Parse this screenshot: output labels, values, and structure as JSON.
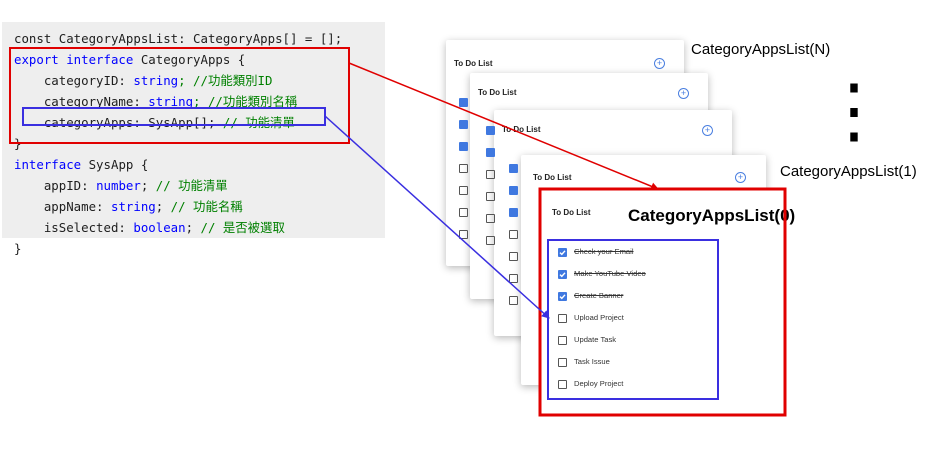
{
  "code_lines": [
    [
      {
        "t": "const CategoryAppsList: CategoryApps[] = [];",
        "c": ""
      }
    ],
    [
      {
        "t": "export interface",
        "c": "kw"
      },
      {
        "t": " CategoryApps {",
        "c": ""
      }
    ],
    [
      {
        "t": "    categoryID: ",
        "c": ""
      },
      {
        "t": "string",
        "c": "kw"
      },
      {
        "t": "; //功能類別ID",
        "c": "cm"
      }
    ],
    [
      {
        "t": "    categoryName: ",
        "c": ""
      },
      {
        "t": "string",
        "c": "kw"
      },
      {
        "t": "; //功能類別名稱",
        "c": "cm"
      }
    ],
    [
      {
        "t": "    categoryApps: SysApp[]; ",
        "c": ""
      },
      {
        "t": "// 功能清單",
        "c": "cm"
      }
    ],
    [
      {
        "t": "}",
        "c": ""
      }
    ],
    [
      {
        "t": "interface",
        "c": "kw"
      },
      {
        "t": " SysApp {",
        "c": ""
      }
    ],
    [
      {
        "t": "    appID: ",
        "c": ""
      },
      {
        "t": "number",
        "c": "kw"
      },
      {
        "t": "; ",
        "c": ""
      },
      {
        "t": "// 功能清單",
        "c": "cm"
      }
    ],
    [
      {
        "t": "    appName: ",
        "c": ""
      },
      {
        "t": "string",
        "c": "kw"
      },
      {
        "t": "; ",
        "c": ""
      },
      {
        "t": "// 功能名稱",
        "c": "cm"
      }
    ],
    [
      {
        "t": "    isSelected: ",
        "c": ""
      },
      {
        "t": "boolean",
        "c": "kw"
      },
      {
        "t": "; ",
        "c": ""
      },
      {
        "t": "// 是否被選取",
        "c": "cm"
      }
    ],
    [
      {
        "t": "}",
        "c": ""
      }
    ]
  ],
  "card_title": "To Do List",
  "tasks": [
    {
      "label": "Check your Email",
      "checked": true
    },
    {
      "label": "Make YouTube Video",
      "checked": true
    },
    {
      "label": "Create Banner",
      "checked": true
    },
    {
      "label": "Upload Project",
      "checked": false
    },
    {
      "label": "Update Task",
      "checked": false
    },
    {
      "label": "Task Issue",
      "checked": false
    },
    {
      "label": "Deploy Project",
      "checked": false
    }
  ],
  "labels": {
    "list_n": "CategoryAppsList(N)",
    "list_1": "CategoryAppsList(1)",
    "list_0": "CategoryAppsList(0)",
    "ellipsis": "⋮"
  },
  "colors": {
    "red": "#e00000",
    "blue": "#3a2fe0",
    "check": "#3f78e0"
  }
}
